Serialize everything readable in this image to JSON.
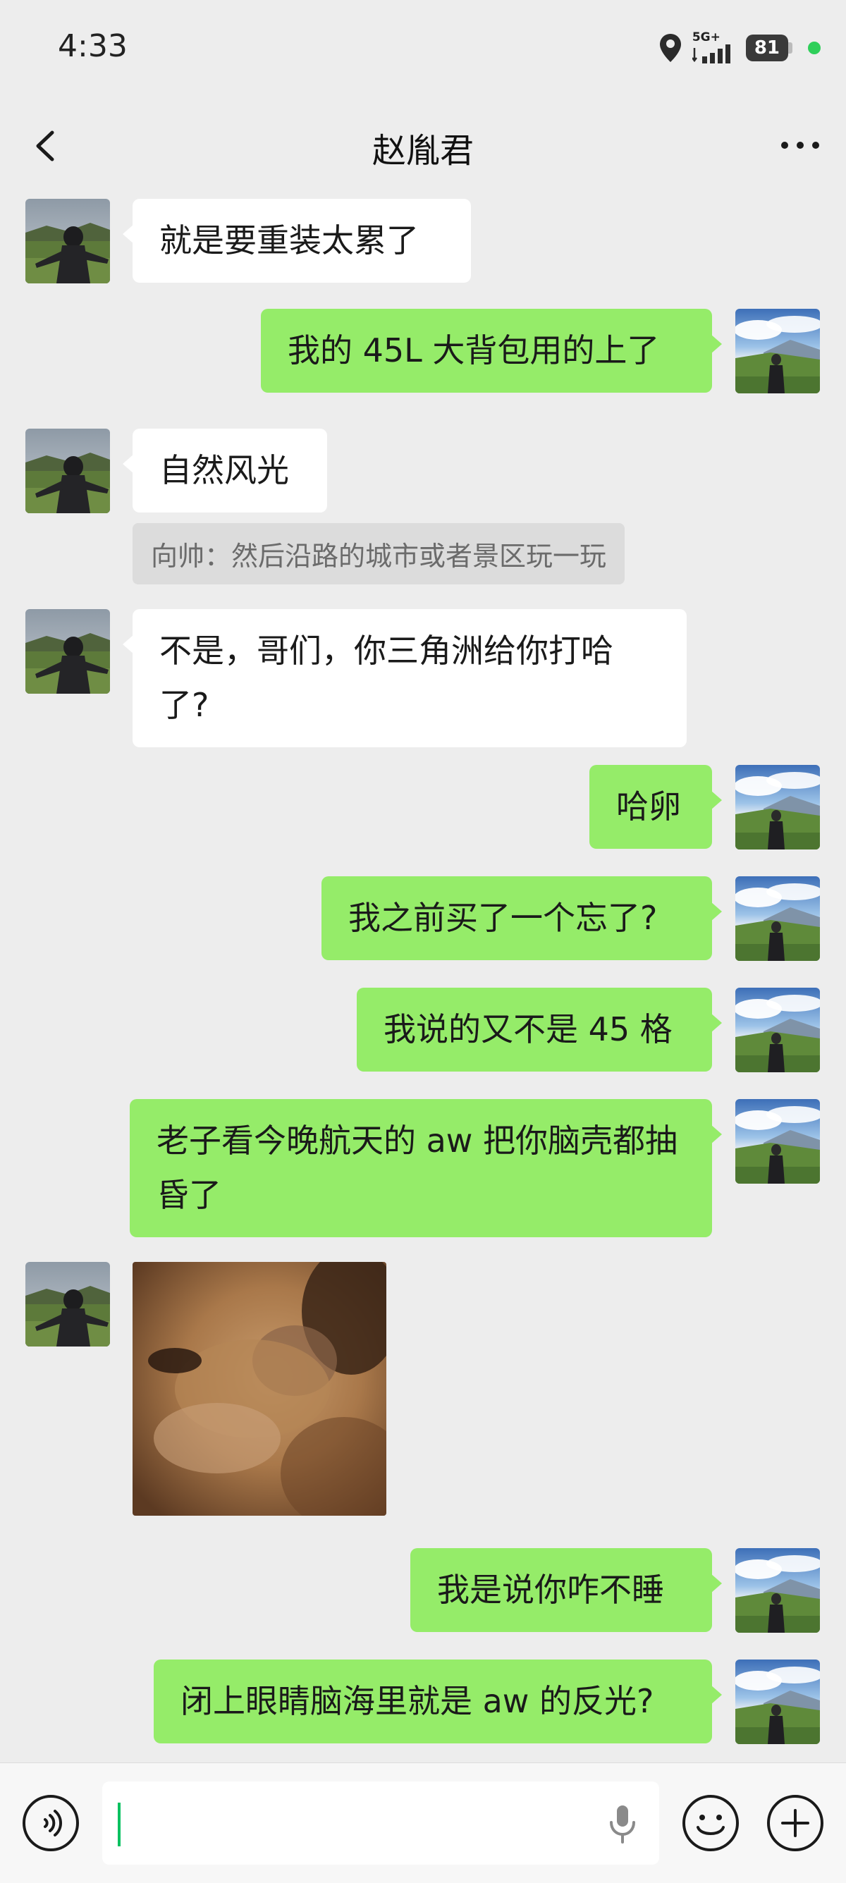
{
  "status": {
    "time": "4:33",
    "network": "5G+",
    "battery": "81"
  },
  "header": {
    "title": "赵胤君"
  },
  "messages": [
    {
      "side": "left",
      "text": "就是要重装太累了"
    },
    {
      "side": "right",
      "text": "我的 45L 大背包用的上了"
    },
    {
      "side": "left",
      "text": "自然风光",
      "quote": "向帅：然后沿路的城市或者景区玩一玩"
    },
    {
      "side": "left",
      "text": "不是，哥们，你三角洲给你打哈了?"
    },
    {
      "side": "right",
      "text": "哈卵"
    },
    {
      "side": "right",
      "text": "我之前买了一个忘了?"
    },
    {
      "side": "right",
      "text": "我说的又不是 45 格"
    },
    {
      "side": "right",
      "text": "老子看今晚航天的 aw 把你脑壳都抽昏了"
    },
    {
      "side": "left",
      "type": "sticker",
      "sticker": "cat-closeup-sticker"
    },
    {
      "side": "right",
      "text": "我是说你咋不睡"
    },
    {
      "side": "right",
      "text": "闭上眼睛脑海里就是 aw 的反光?"
    }
  ],
  "input": {
    "value": ""
  },
  "icons": {
    "back": "chevron-left-icon",
    "more": "more-dots-icon",
    "voice": "voice-icon",
    "mic": "microphone-icon",
    "emoji": "emoji-icon",
    "plus": "plus-icon",
    "location": "location-icon",
    "signal": "signal-icon"
  },
  "colors": {
    "background": "#ededed",
    "own_bubble": "#95ec69",
    "other_bubble": "#ffffff",
    "accent": "#07c160"
  }
}
